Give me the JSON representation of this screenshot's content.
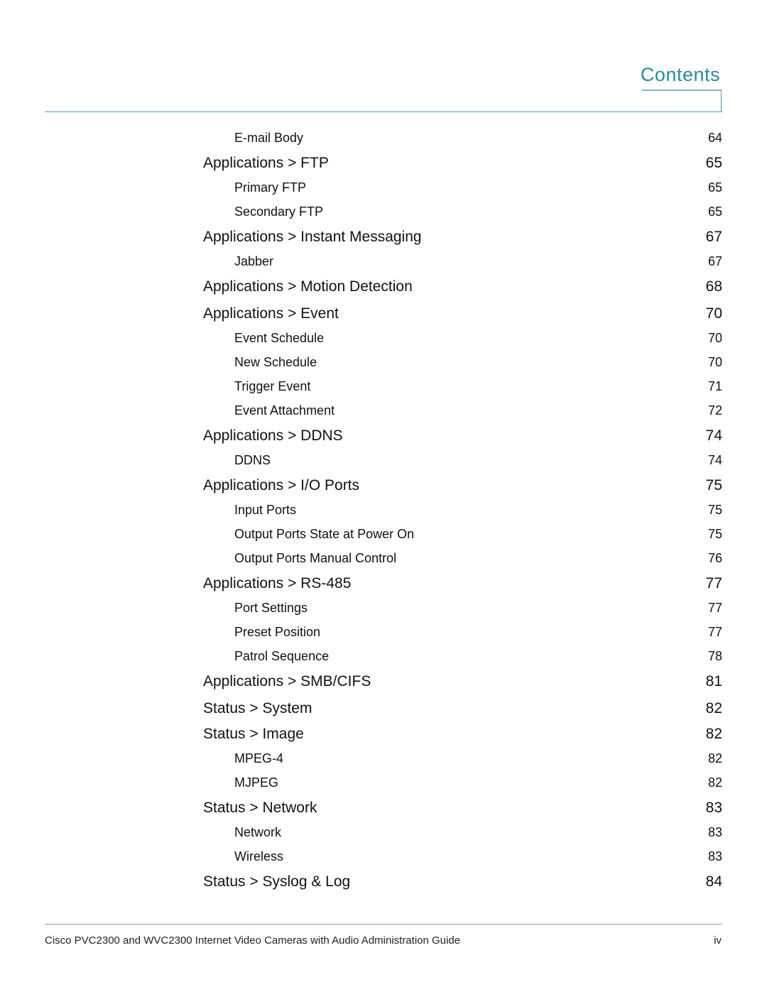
{
  "header": {
    "title": "Contents"
  },
  "toc": [
    {
      "level": 2,
      "title": "E-mail Body",
      "page": "64"
    },
    {
      "level": 1,
      "title": "Applications > FTP",
      "page": "65"
    },
    {
      "level": 2,
      "title": "Primary FTP",
      "page": "65"
    },
    {
      "level": 2,
      "title": "Secondary FTP",
      "page": "65"
    },
    {
      "level": 1,
      "title": "Applications > Instant Messaging",
      "page": "67"
    },
    {
      "level": 2,
      "title": "Jabber",
      "page": "67"
    },
    {
      "level": 1,
      "title": "Applications > Motion Detection",
      "page": "68"
    },
    {
      "level": 1,
      "title": "Applications > Event",
      "page": "70"
    },
    {
      "level": 2,
      "title": "Event Schedule",
      "page": "70"
    },
    {
      "level": 2,
      "title": "New Schedule",
      "page": "70"
    },
    {
      "level": 2,
      "title": "Trigger Event",
      "page": "71"
    },
    {
      "level": 2,
      "title": "Event Attachment",
      "page": "72"
    },
    {
      "level": 1,
      "title": "Applications > DDNS",
      "page": "74"
    },
    {
      "level": 2,
      "title": "DDNS",
      "page": "74"
    },
    {
      "level": 1,
      "title": "Applications > I/O Ports",
      "page": "75"
    },
    {
      "level": 2,
      "title": "Input Ports",
      "page": "75"
    },
    {
      "level": 2,
      "title": "Output Ports State at Power On",
      "page": "75"
    },
    {
      "level": 2,
      "title": "Output Ports Manual Control",
      "page": "76"
    },
    {
      "level": 1,
      "title": "Applications > RS-485",
      "page": "77"
    },
    {
      "level": 2,
      "title": "Port Settings",
      "page": "77"
    },
    {
      "level": 2,
      "title": "Preset Position",
      "page": "77"
    },
    {
      "level": 2,
      "title": "Patrol Sequence",
      "page": "78"
    },
    {
      "level": 1,
      "title": "Applications > SMB/CIFS",
      "page": "81"
    },
    {
      "level": 1,
      "title": "Status > System",
      "page": "82"
    },
    {
      "level": 1,
      "title": "Status > Image",
      "page": "82"
    },
    {
      "level": 2,
      "title": "MPEG-4",
      "page": "82"
    },
    {
      "level": 2,
      "title": "MJPEG",
      "page": "82"
    },
    {
      "level": 1,
      "title": "Status > Network",
      "page": "83"
    },
    {
      "level": 2,
      "title": "Network",
      "page": "83"
    },
    {
      "level": 2,
      "title": "Wireless",
      "page": "83"
    },
    {
      "level": 1,
      "title": "Status > Syslog & Log",
      "page": "84"
    }
  ],
  "footer": {
    "text": "Cisco PVC2300 and WVC2300 Internet Video Cameras with Audio Administration Guide",
    "page": "iv"
  }
}
